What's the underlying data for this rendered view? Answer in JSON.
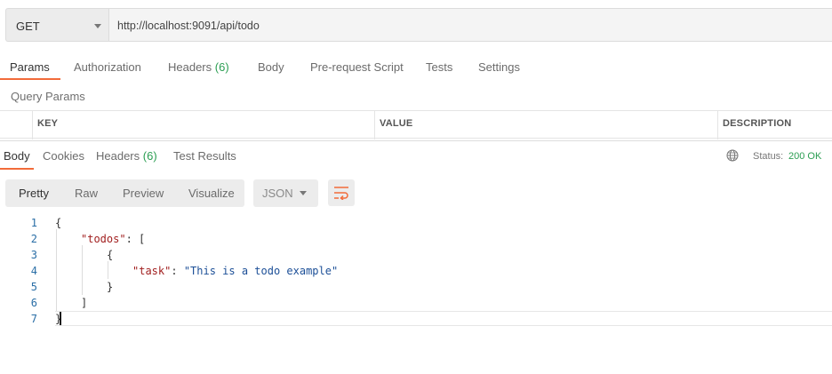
{
  "request": {
    "method": "GET",
    "url": "http://localhost:9091/api/todo"
  },
  "request_tabs": [
    {
      "label": "Params"
    },
    {
      "label": "Authorization"
    },
    {
      "label": "Headers",
      "count": "(6)"
    },
    {
      "label": "Body"
    },
    {
      "label": "Pre-request Script"
    },
    {
      "label": "Tests"
    },
    {
      "label": "Settings"
    }
  ],
  "query_params": {
    "title": "Query Params",
    "columns": [
      "KEY",
      "VALUE",
      "DESCRIPTION"
    ]
  },
  "response_tabs": [
    {
      "label": "Body"
    },
    {
      "label": "Cookies"
    },
    {
      "label": "Headers",
      "count": "(6)"
    },
    {
      "label": "Test Results"
    }
  ],
  "status": {
    "label": "Status:",
    "value": "200 OK",
    "icon": "globe-icon"
  },
  "view_modes": [
    "Pretty",
    "Raw",
    "Preview",
    "Visualize"
  ],
  "format": "JSON",
  "wrap_icon": "wrap-lines-icon",
  "code": {
    "line_numbers": [
      "1",
      "2",
      "3",
      "4",
      "5",
      "6",
      "7"
    ],
    "tokens": {
      "open_brace": "{",
      "todos_key": "\"todos\"",
      "colon1": ": ",
      "open_bracket": "[",
      "inner_open": "{",
      "task_key": "\"task\"",
      "colon2": ": ",
      "task_value": "\"This is a todo example\"",
      "inner_close": "}",
      "close_bracket": "]",
      "close_brace": "}"
    }
  },
  "colors": {
    "accent": "#f26b3a",
    "success": "#2b9e52",
    "json_key": "#a11f1f",
    "json_string": "#1c4f97"
  }
}
